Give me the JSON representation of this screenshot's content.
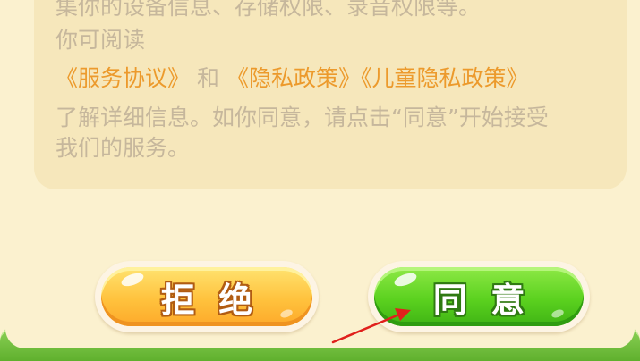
{
  "consent_dialog": {
    "partial_line": "集你的设备信息、存储权限、录音权限等。",
    "read_prompt": "你可阅读",
    "link_service_agreement": "《服务协议》",
    "and_word": "和",
    "link_privacy_policy": "《隐私政策》",
    "link_child_privacy_policy": "《儿童隐私政策》",
    "details_line_1": "了解详细信息。如你同意，请点击“同意”开始接受",
    "details_line_2": "我们的服务。"
  },
  "buttons": {
    "refuse_label": "拒  绝",
    "agree_label": "同  意"
  },
  "colors": {
    "dialog_background": "#fbf1cf",
    "text_muted": "#c6b79c",
    "link_orange": "#ec9a2c",
    "refuse_button": "#ffc23d",
    "agree_button": "#5bd11f",
    "bottom_bar_green": "#6fbf3a",
    "annotation_arrow": "#e0201c"
  },
  "icons": {
    "annotation": "red-arrow-pointer"
  }
}
